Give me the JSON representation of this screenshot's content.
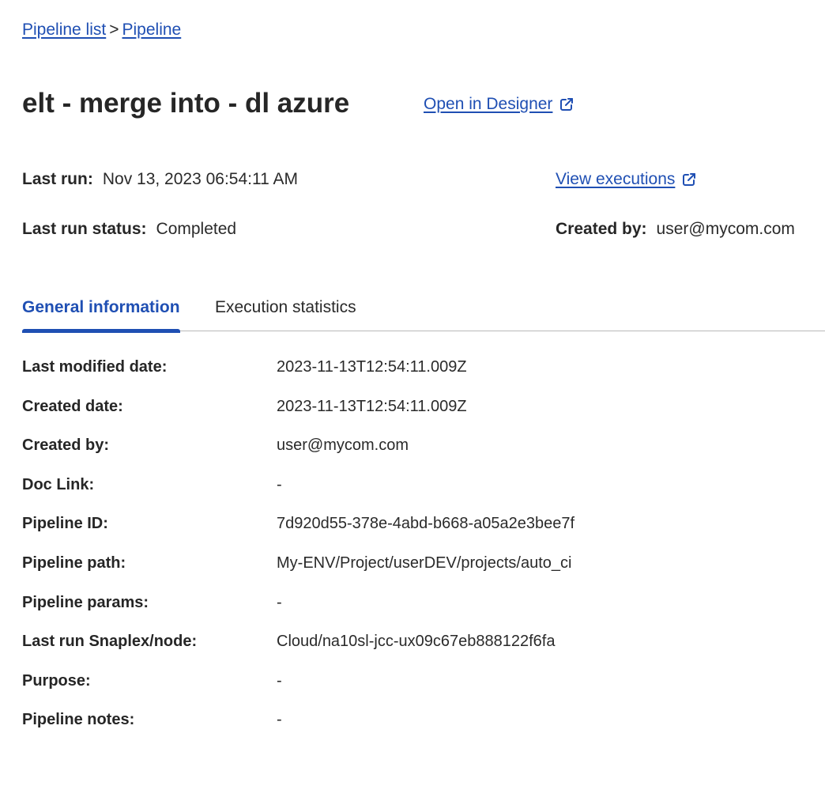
{
  "breadcrumb": {
    "items": [
      "Pipeline list",
      "Pipeline"
    ],
    "separator": ">"
  },
  "title": "elt - merge into - dl azure",
  "open_designer_label": "Open in Designer",
  "summary": {
    "last_run_label": "Last run:",
    "last_run_value": "Nov 13, 2023 06:54:11 AM",
    "last_status_label": "Last run status:",
    "last_status_value": "Completed",
    "view_executions_label": "View executions",
    "created_by_label": "Created by:",
    "created_by_value": "user@mycom.com"
  },
  "tabs": [
    {
      "label": "General information",
      "active": true
    },
    {
      "label": "Execution statistics",
      "active": false
    }
  ],
  "general_info": [
    {
      "label": "Last modified date:",
      "value": "2023-11-13T12:54:11.009Z"
    },
    {
      "label": "Created date:",
      "value": "2023-11-13T12:54:11.009Z"
    },
    {
      "label": "Created by:",
      "value": "user@mycom.com"
    },
    {
      "label": "Doc Link:",
      "value": "-"
    },
    {
      "label": "Pipeline ID:",
      "value": "7d920d55-378e-4abd-b668-a05a2e3bee7f"
    },
    {
      "label": "Pipeline path:",
      "value": "My-ENV/Project/userDEV/projects/auto_ci"
    },
    {
      "label": "Pipeline params:",
      "value": "-"
    },
    {
      "label": "Last run Snaplex/node:",
      "value": "Cloud/na10sl-jcc-ux09c67eb888122f6fa"
    },
    {
      "label": "Purpose:",
      "value": "-"
    },
    {
      "label": "Pipeline notes:",
      "value": "-"
    }
  ],
  "colors": {
    "link": "#1f4fb3",
    "text": "#2a2a2a",
    "divider": "#b9b9b9"
  },
  "icons": {
    "external_link": "external-link-icon"
  }
}
